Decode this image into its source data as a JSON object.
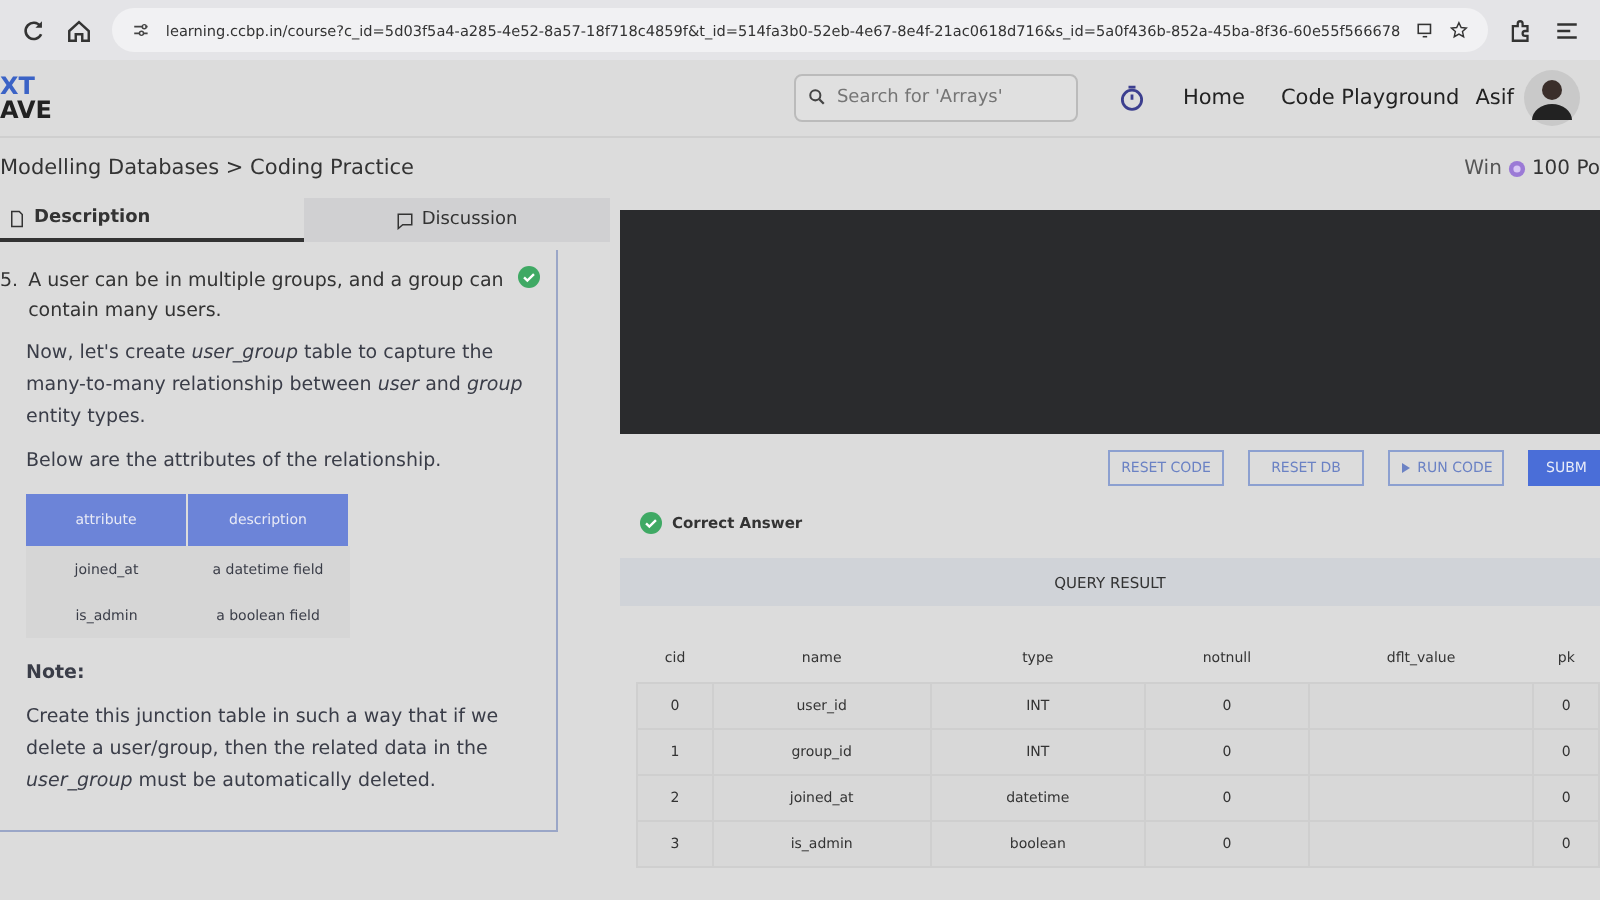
{
  "browser": {
    "url": "learning.ccbp.in/course?c_id=5d03f5a4-a285-4e52-8a57-18f718c4859f&t_id=514fa3b0-52eb-4e67-8e4f-21ac0618d716&s_id=5a0f436b-852a-45ba-8f36-60e55f566678"
  },
  "header": {
    "logo_top": "XT",
    "logo_bottom": "AVE",
    "search": {
      "placeholder": "Search for 'Arrays'"
    },
    "nav": [
      "Home",
      "Code Playground"
    ],
    "user": "Asif"
  },
  "breadcrumb": "Modelling Databases > Coding Practice",
  "reward": {
    "prefix": "Win",
    "text": "100 Po"
  },
  "tabs": [
    {
      "label": "Description",
      "selected": true,
      "kind": "doc"
    },
    {
      "label": "Discussion",
      "selected": false,
      "kind": "chat"
    }
  ],
  "question": {
    "number": "5.",
    "solved": true,
    "text": "A user can be in multiple groups, and a group can contain many users.",
    "paragraphs": [
      "Now, let's create *user_group* table to capture the many-to-many relationship between *user* and *group* entity types.",
      "Below are the attributes of the relationship."
    ],
    "attr_table": {
      "columns": [
        "attribute",
        "description"
      ],
      "rows": [
        [
          "joined_at",
          "a datetime field"
        ],
        [
          "is_admin",
          "a boolean field"
        ]
      ]
    },
    "note_title": "Note:",
    "note": "Create this junction table in such a way that if we delete a user/group, then the related data in the *user_group* must be automatically deleted."
  },
  "buttons": [
    {
      "label": "RESET CODE",
      "kind": "outline"
    },
    {
      "label": "RESET DB",
      "kind": "outline"
    },
    {
      "label": "RUN CODE",
      "kind": "run"
    },
    {
      "label": "SUBM",
      "kind": "primary"
    }
  ],
  "result": {
    "status": "Correct Answer",
    "correct": true,
    "title": "QUERY RESULT",
    "columns": [
      "cid",
      "name",
      "type",
      "notnull",
      "dflt_value",
      "pk"
    ],
    "rows": [
      [
        "0",
        "user_id",
        "INT",
        "0",
        "",
        "0"
      ],
      [
        "1",
        "group_id",
        "INT",
        "0",
        "",
        "0"
      ],
      [
        "2",
        "joined_at",
        "datetime",
        "0",
        "",
        "0"
      ],
      [
        "3",
        "is_admin",
        "boolean",
        "0",
        "",
        "0"
      ]
    ]
  }
}
